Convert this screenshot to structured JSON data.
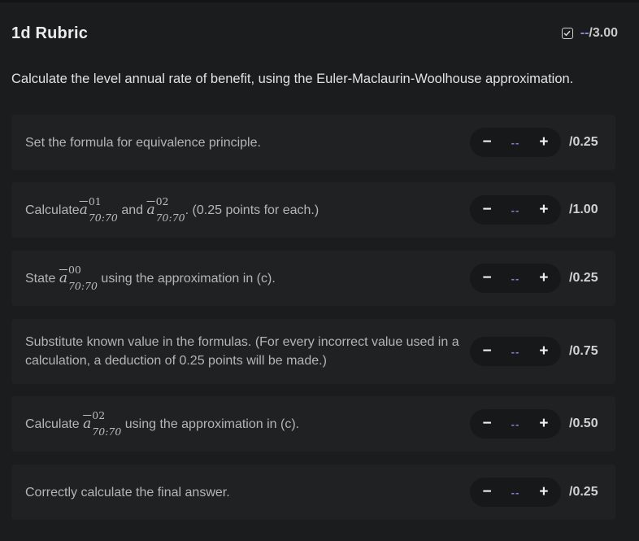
{
  "header": {
    "title": "1d Rubric",
    "score_value": "--",
    "score_total": "/3.00"
  },
  "question": "Calculate the level annual rate of benefit, using the Euler-Maclaurin-Woolhouse approximation.",
  "items": [
    {
      "text": "Set the formula for equivalence principle.",
      "value": "--",
      "points": "/0.25"
    },
    {
      "text_before": "Calculate ",
      "math1_base": "a",
      "math1_sup": "01",
      "math1_sub": "70:70",
      "text_mid": " and ",
      "math2_base": "a",
      "math2_sup": "02",
      "math2_sub": "70:70",
      "text_after": ". (0.25 points for each.)",
      "value": "--",
      "points": "/1.00"
    },
    {
      "text_before": "State ",
      "math1_base": "a",
      "math1_sup": "00",
      "math1_sub": "70:70",
      "text_after": " using the approximation in (c).",
      "value": "--",
      "points": "/0.25"
    },
    {
      "text": "Substitute known value in the formulas. (For every incorrect value used in a calculation, a deduction of 0.25 points will be made.)",
      "value": "--",
      "points": "/0.75"
    },
    {
      "text_before": "Calculate ",
      "math1_base": "a",
      "math1_sup": "02",
      "math1_sub": "70:70",
      "text_after": " using the approximation in (c).",
      "value": "--",
      "points": "/0.50"
    },
    {
      "text": "Correctly calculate the final answer.",
      "value": "--",
      "points": "/0.25"
    }
  ],
  "controls": {
    "minus": "−",
    "plus": "+"
  },
  "colors": {
    "background": "#1b1c1d",
    "card": "#202122",
    "accent": "#8a8fd8"
  },
  "icons": {
    "score_status": "checkbox-icon"
  }
}
